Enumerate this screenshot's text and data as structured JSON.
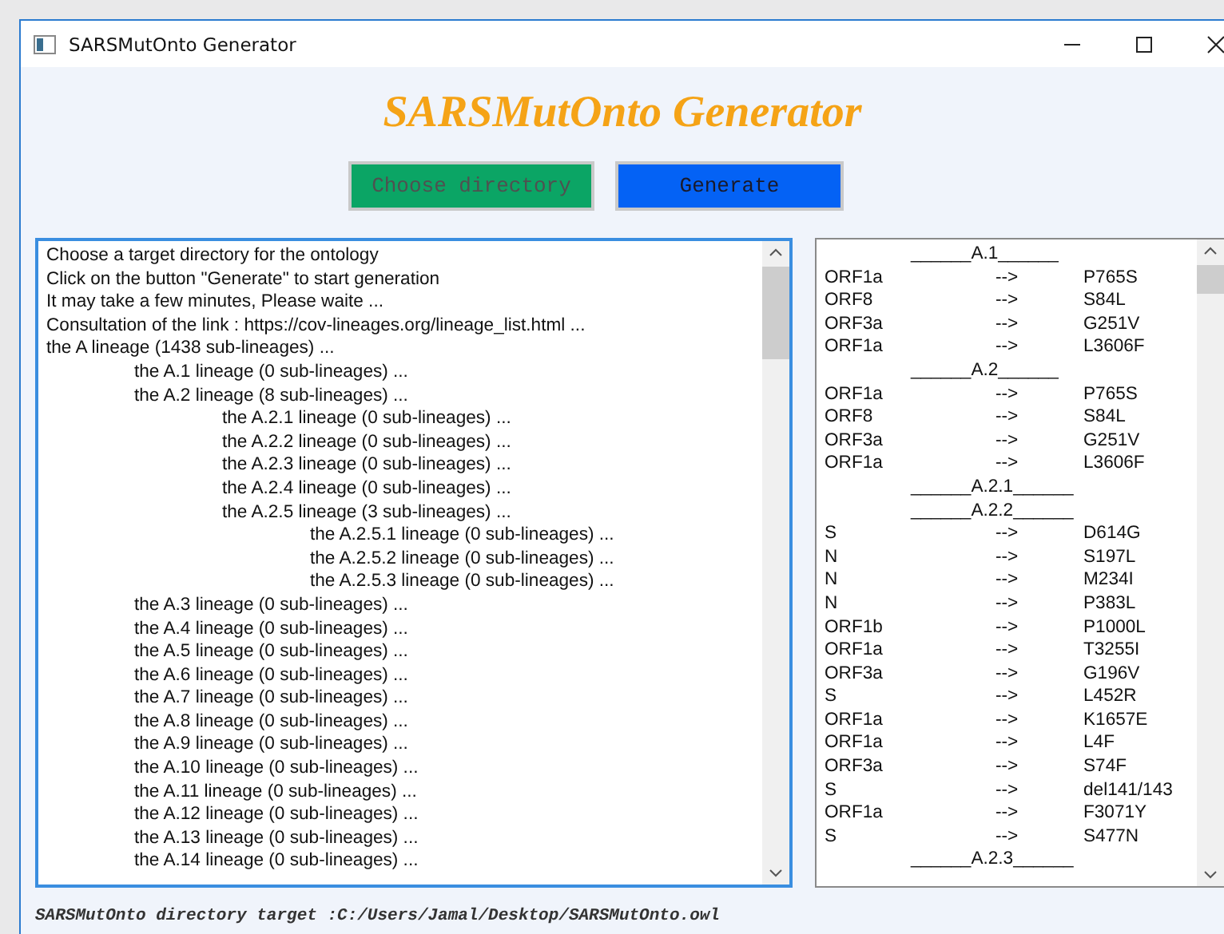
{
  "window": {
    "title": "SARSMutOnto Generator"
  },
  "heading": "SARSMutOnto Generator",
  "buttons": [
    {
      "label": "Choose directory",
      "kind": "choose"
    },
    {
      "label": "Generate",
      "kind": "generate"
    }
  ],
  "log": {
    "lines": [
      {
        "text": "Choose a target directory for the ontology"
      },
      {
        "text": "Click on the button \"Generate\" to start generation"
      },
      {
        "text": "It may take a few minutes, Please waite ..."
      },
      {
        "text": "Consultation of the link : https://cov-lineages.org/lineage_list.html  ..."
      },
      {
        "text": "the A lineage (1438 sub-lineages) ...",
        "children": [
          {
            "text": "the A.1 lineage (0 sub-lineages) ..."
          },
          {
            "text": "the A.2 lineage (8 sub-lineages) ...",
            "children": [
              {
                "text": "the A.2.1 lineage (0 sub-lineages) ..."
              },
              {
                "text": "the A.2.2 lineage (0 sub-lineages) ..."
              },
              {
                "text": "the A.2.3 lineage (0 sub-lineages) ..."
              },
              {
                "text": "the A.2.4 lineage (0 sub-lineages) ..."
              },
              {
                "text": "the A.2.5 lineage (3 sub-lineages) ...",
                "children": [
                  {
                    "text": "the A.2.5.1 lineage (0 sub-lineages) ..."
                  },
                  {
                    "text": "the A.2.5.2 lineage (0 sub-lineages) ..."
                  },
                  {
                    "text": "the A.2.5.3 lineage (0 sub-lineages) ..."
                  }
                ]
              }
            ]
          },
          {
            "text": "the A.3 lineage (0 sub-lineages) ..."
          },
          {
            "text": "the A.4 lineage (0 sub-lineages) ..."
          },
          {
            "text": "the A.5 lineage (0 sub-lineages) ..."
          },
          {
            "text": "the A.6 lineage (0 sub-lineages) ..."
          },
          {
            "text": "the A.7 lineage (0 sub-lineages) ..."
          },
          {
            "text": "the A.8 lineage (0 sub-lineages) ..."
          },
          {
            "text": "the A.9 lineage (0 sub-lineages) ..."
          },
          {
            "text": "the A.10 lineage (0 sub-lineages) ..."
          },
          {
            "text": "the A.11 lineage (0 sub-lineages) ..."
          },
          {
            "text": "the A.12 lineage (0 sub-lineages) ..."
          },
          {
            "text": "the A.13 lineage (0 sub-lineages) ..."
          },
          {
            "text": "the A.14 lineage (0 sub-lineages) ..."
          }
        ]
      }
    ]
  },
  "mutations": [
    {
      "kind": "header",
      "text": "______A.1______"
    },
    {
      "kind": "row",
      "gene": "ORF1a",
      "arrow": "-->",
      "mutation": "P765S"
    },
    {
      "kind": "row",
      "gene": "ORF8",
      "arrow": "-->",
      "mutation": "S84L"
    },
    {
      "kind": "row",
      "gene": "ORF3a",
      "arrow": "-->",
      "mutation": "G251V"
    },
    {
      "kind": "row",
      "gene": "ORF1a",
      "arrow": "-->",
      "mutation": "L3606F"
    },
    {
      "kind": "header",
      "text": "______A.2______"
    },
    {
      "kind": "row",
      "gene": "ORF1a",
      "arrow": "-->",
      "mutation": "P765S"
    },
    {
      "kind": "row",
      "gene": "ORF8",
      "arrow": "-->",
      "mutation": "S84L"
    },
    {
      "kind": "row",
      "gene": "ORF3a",
      "arrow": "-->",
      "mutation": "G251V"
    },
    {
      "kind": "row",
      "gene": "ORF1a",
      "arrow": "-->",
      "mutation": "L3606F"
    },
    {
      "kind": "header",
      "text": "______A.2.1______"
    },
    {
      "kind": "header",
      "text": "______A.2.2______"
    },
    {
      "kind": "row",
      "gene": "S",
      "arrow": "-->",
      "mutation": "D614G"
    },
    {
      "kind": "row",
      "gene": "N",
      "arrow": "-->",
      "mutation": "S197L"
    },
    {
      "kind": "row",
      "gene": "N",
      "arrow": "-->",
      "mutation": "M234I"
    },
    {
      "kind": "row",
      "gene": "N",
      "arrow": "-->",
      "mutation": "P383L"
    },
    {
      "kind": "row",
      "gene": "ORF1b",
      "arrow": "-->",
      "mutation": "P1000L"
    },
    {
      "kind": "row",
      "gene": "ORF1a",
      "arrow": "-->",
      "mutation": "T3255I"
    },
    {
      "kind": "row",
      "gene": "ORF3a",
      "arrow": "-->",
      "mutation": "G196V"
    },
    {
      "kind": "row",
      "gene": "S",
      "arrow": "-->",
      "mutation": "L452R"
    },
    {
      "kind": "row",
      "gene": "ORF1a",
      "arrow": "-->",
      "mutation": "K1657E"
    },
    {
      "kind": "row",
      "gene": "ORF1a",
      "arrow": "-->",
      "mutation": "L4F"
    },
    {
      "kind": "row",
      "gene": "ORF3a",
      "arrow": "-->",
      "mutation": "S74F"
    },
    {
      "kind": "row",
      "gene": "S",
      "arrow": "-->",
      "mutation": "del141/143"
    },
    {
      "kind": "row",
      "gene": "ORF1a",
      "arrow": "-->",
      "mutation": "F3071Y"
    },
    {
      "kind": "row",
      "gene": "S",
      "arrow": "-->",
      "mutation": "S477N"
    },
    {
      "kind": "header",
      "text": "______A.2.3______"
    }
  ],
  "status": "SARSMutOnto directory target :C:/Users/Jamal/Desktop/SARSMutOnto.owl"
}
